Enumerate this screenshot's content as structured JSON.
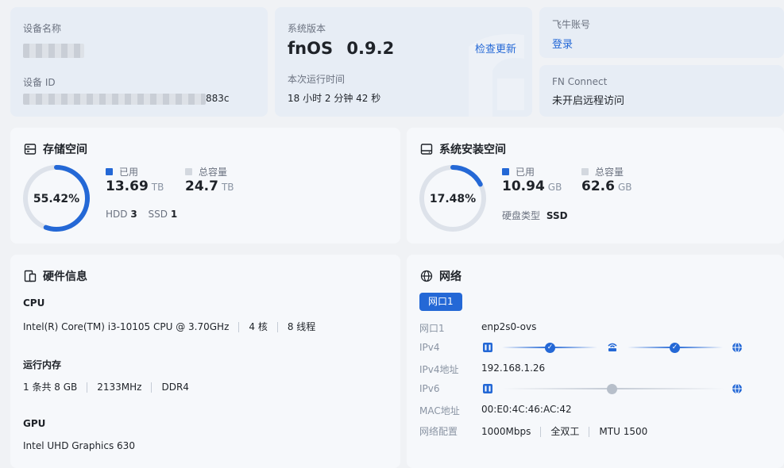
{
  "device": {
    "name_label": "设备名称",
    "id_label": "设备 ID",
    "id_suffix": "883c"
  },
  "system": {
    "version_label": "系统版本",
    "os_name": "fnOS",
    "os_version": "0.9.2",
    "check_update": "检查更新",
    "uptime_label": "本次运行时间",
    "uptime_value": "18 小时 2 分钟 42 秒"
  },
  "account": {
    "label": "飞牛账号",
    "login": "登录"
  },
  "fn_connect": {
    "label": "FN Connect",
    "value": "未开启远程访问"
  },
  "storage": {
    "title": "存储空间",
    "percent_text": "55.42%",
    "used_fraction": 0.5542,
    "used_label": "已用",
    "used_value": "13.69",
    "used_unit": "TB",
    "total_label": "总容量",
    "total_value": "24.7",
    "total_unit": "TB",
    "hdd_label": "HDD",
    "hdd_count": "3",
    "ssd_label": "SSD",
    "ssd_count": "1"
  },
  "system_space": {
    "title": "系统安装空间",
    "percent_text": "17.48%",
    "used_fraction": 0.1748,
    "used_label": "已用",
    "used_value": "10.94",
    "used_unit": "GB",
    "total_label": "总容量",
    "total_value": "62.6",
    "total_unit": "GB",
    "disk_type_label": "硬盘类型",
    "disk_type_value": "SSD"
  },
  "hardware": {
    "title": "硬件信息",
    "cpu_label": "CPU",
    "cpu_model": "Intel(R) Core(TM) i3-10105 CPU @ 3.70GHz",
    "cpu_cores": "4 核",
    "cpu_threads": "8 线程",
    "mem_label": "运行内存",
    "mem_size": "1 条共 8 GB",
    "mem_freq": "2133MHz",
    "mem_type": "DDR4",
    "gpu_label": "GPU",
    "gpu_model": "Intel UHD Graphics 630"
  },
  "network": {
    "title": "网络",
    "tab": "网口1",
    "port_label": "网口1",
    "port_value": "enp2s0-ovs",
    "ipv4_label": "IPv4",
    "ipv4_addr_label": "IPv4地址",
    "ipv4_addr_value": "192.168.1.26",
    "ipv6_label": "IPv6",
    "mac_label": "MAC地址",
    "mac_value": "00:E0:4C:46:AC:42",
    "config_label": "网络配置",
    "speed": "1000Mbps",
    "duplex": "全双工",
    "mtu": "MTU 1500"
  },
  "colors": {
    "accent": "#2468d6",
    "ring_track": "#dde2ea",
    "legend_total": "#d3d8df"
  }
}
